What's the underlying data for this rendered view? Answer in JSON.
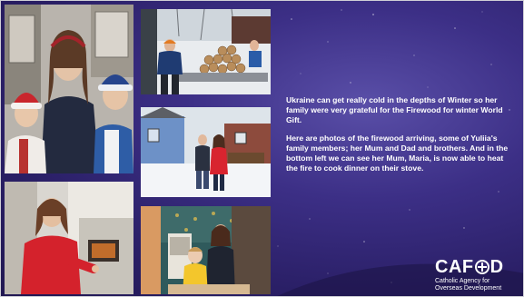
{
  "caption": {
    "paragraph1": "Ukraine can get really cold in the depths of Winter so her family were very grateful for the Firewood for winter World Gift.",
    "paragraph2": "Here are photos of the firewood arriving, some of Yuliia's family members; her Mum and Dad and brothers. And in the bottom left we can see her Mum, Maria, is now able to heat the fire to cook dinner on their stove."
  },
  "logo": {
    "word_left": "CAF",
    "word_right": "D",
    "subtitle_line1": "Catholic Agency for",
    "subtitle_line2": "Overseas Development"
  },
  "colors": {
    "background": "#2a1f66",
    "accent": "#5a4fa8",
    "text": "#ffffff"
  }
}
